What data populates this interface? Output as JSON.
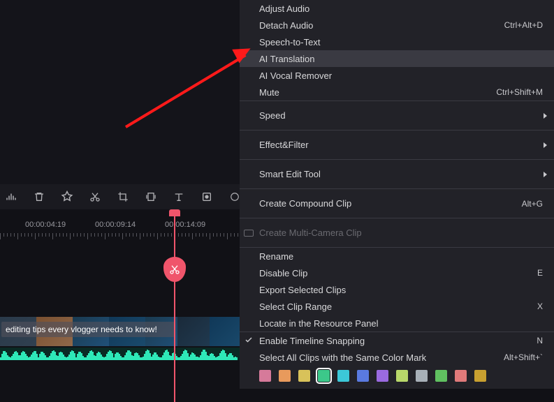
{
  "timeline": {
    "labels": [
      "00:00:04:19",
      "00:00:09:14",
      "00:00:14:09"
    ],
    "clip_text": "editing tips every vlogger needs to know!"
  },
  "menu": {
    "adjust_audio": "Adjust Audio",
    "detach_audio": "Detach Audio",
    "detach_audio_sc": "Ctrl+Alt+D",
    "speech_to_text": "Speech-to-Text",
    "ai_translation": "AI Translation",
    "ai_vocal_remover": "AI Vocal Remover",
    "mute": "Mute",
    "mute_sc": "Ctrl+Shift+M",
    "speed": "Speed",
    "effect_filter": "Effect&Filter",
    "smart_edit": "Smart Edit Tool",
    "create_compound": "Create Compound Clip",
    "create_compound_sc": "Alt+G",
    "create_multicam": "Create Multi-Camera Clip",
    "rename": "Rename",
    "disable_clip": "Disable Clip",
    "disable_clip_sc": "E",
    "export_selected": "Export Selected Clips",
    "select_clip_range": "Select Clip Range",
    "select_clip_range_sc": "X",
    "locate_resource": "Locate in the Resource Panel",
    "enable_snapping": "Enable Timeline Snapping",
    "enable_snapping_sc": "N",
    "select_same_color": "Select All Clips with the Same Color Mark",
    "select_same_color_sc": "Alt+Shift+`"
  },
  "colors": {
    "swatches": [
      "#d67a9a",
      "#e89a5c",
      "#d8c25a",
      "#3cc88a",
      "#3cc8d8",
      "#5a7ae0",
      "#9a6ae0",
      "#b8d86a",
      "#a8b0b8",
      "#60c060",
      "#e07a7a",
      "#c8a030"
    ],
    "selected_index": 3
  }
}
